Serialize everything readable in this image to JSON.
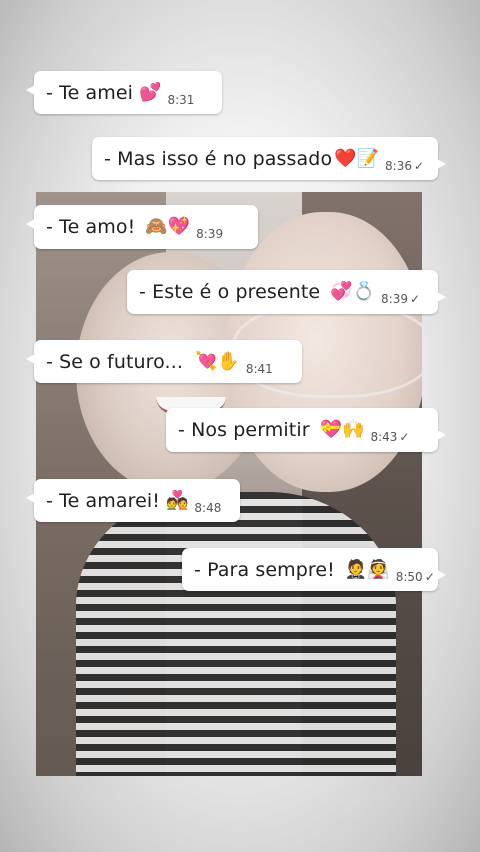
{
  "messages": [
    {
      "text": "- Te amei",
      "emoji": "💕",
      "time": "8:31",
      "direction": "in",
      "tick": ""
    },
    {
      "text": "- Mas isso é no passado",
      "emoji": "❤️📝",
      "time": "8:36",
      "direction": "out",
      "tick": "✓"
    },
    {
      "text": "-  Te amo!",
      "emoji": "🙈💖",
      "time": "8:39",
      "direction": "in",
      "tick": ""
    },
    {
      "text": "- Este é o presente",
      "emoji": "💞💍",
      "time": "8:39",
      "direction": "out",
      "tick": "✓"
    },
    {
      "text": "-  Se o futuro...",
      "emoji": "💘✋",
      "time": "8:41",
      "direction": "in",
      "tick": ""
    },
    {
      "text": "-  Nos permitir",
      "emoji": "💝🙌",
      "time": "8:43",
      "direction": "out",
      "tick": "✓"
    },
    {
      "text": "- Te amarei!",
      "emoji": "💑",
      "time": "8:48",
      "direction": "in",
      "tick": ""
    },
    {
      "text": "- Para sempre!",
      "emoji": "🤵👰",
      "time": "8:50",
      "direction": "out",
      "tick": "✓"
    }
  ],
  "colors": {
    "bubble": "#ffffff",
    "text": "#202020",
    "time": "#555555"
  }
}
